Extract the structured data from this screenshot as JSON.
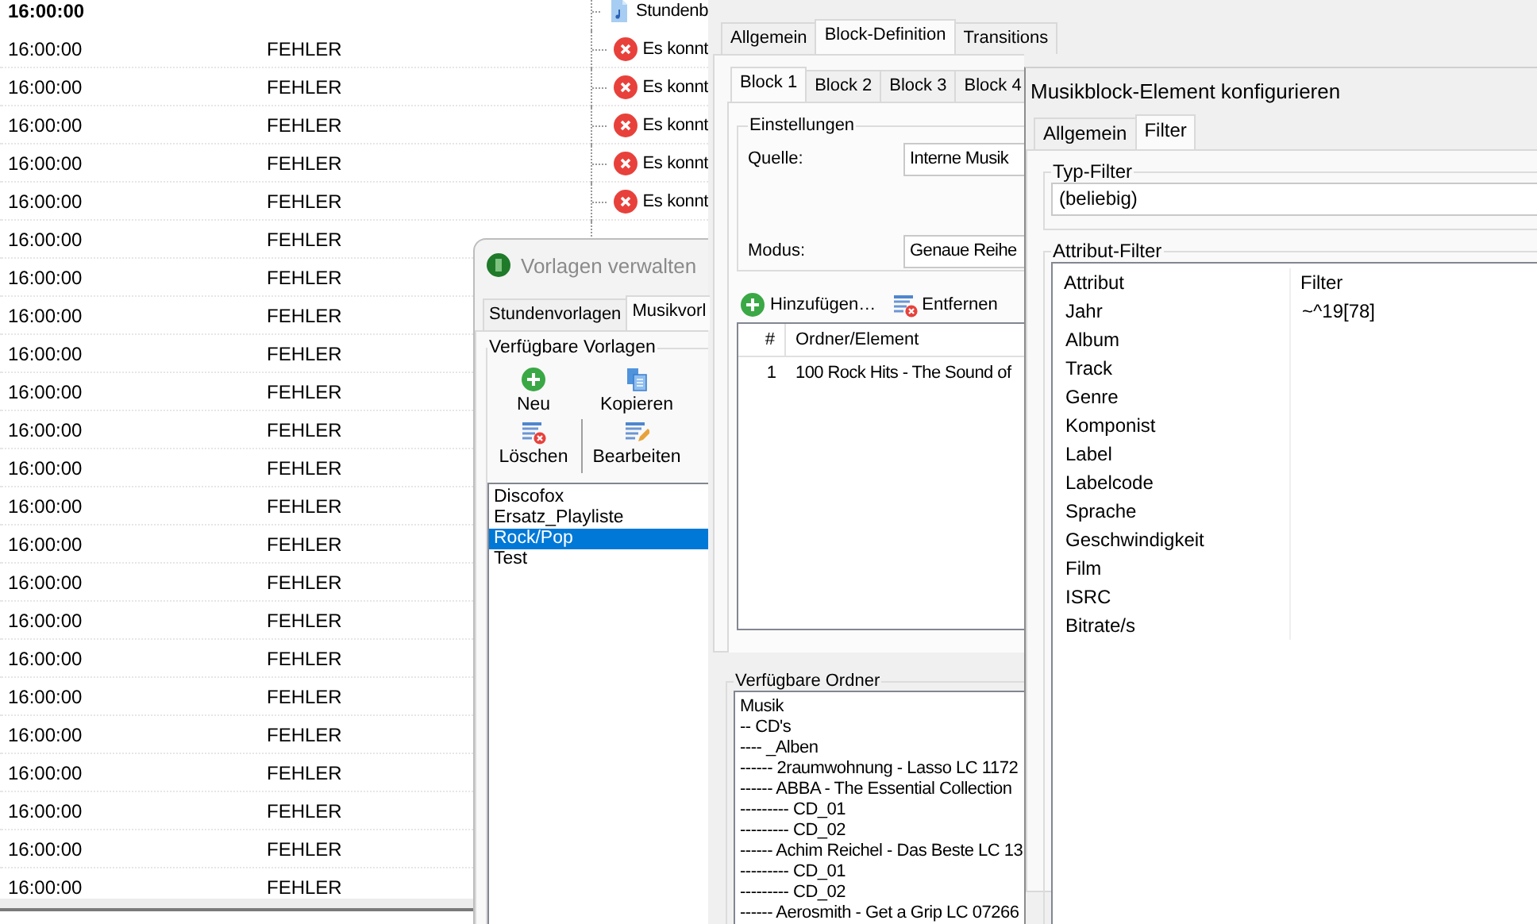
{
  "log": {
    "header": {
      "time": "16:00:00",
      "kind": "file",
      "message": "Stundenb"
    },
    "rows": [
      {
        "time": "16:00:00",
        "status": "FEHLER",
        "kind": "error",
        "message": "Es konnt"
      },
      {
        "time": "16:00:00",
        "status": "FEHLER",
        "kind": "error",
        "message": "Es konnt"
      },
      {
        "time": "16:00:00",
        "status": "FEHLER",
        "kind": "error",
        "message": "Es konnt"
      },
      {
        "time": "16:00:00",
        "status": "FEHLER",
        "kind": "error",
        "message": "Es konnt"
      },
      {
        "time": "16:00:00",
        "status": "FEHLER",
        "kind": "error",
        "message": "Es konnt"
      },
      {
        "time": "16:00:00",
        "status": "FEHLER"
      },
      {
        "time": "16:00:00",
        "status": "FEHLER"
      },
      {
        "time": "16:00:00",
        "status": "FEHLER"
      },
      {
        "time": "16:00:00",
        "status": "FEHLER"
      },
      {
        "time": "16:00:00",
        "status": "FEHLER"
      },
      {
        "time": "16:00:00",
        "status": "FEHLER"
      },
      {
        "time": "16:00:00",
        "status": "FEHLER"
      },
      {
        "time": "16:00:00",
        "status": "FEHLER"
      },
      {
        "time": "16:00:00",
        "status": "FEHLER"
      },
      {
        "time": "16:00:00",
        "status": "FEHLER"
      },
      {
        "time": "16:00:00",
        "status": "FEHLER"
      },
      {
        "time": "16:00:00",
        "status": "FEHLER"
      },
      {
        "time": "16:00:00",
        "status": "FEHLER"
      },
      {
        "time": "16:00:00",
        "status": "FEHLER"
      },
      {
        "time": "16:00:00",
        "status": "FEHLER"
      },
      {
        "time": "16:00:00",
        "status": "FEHLER"
      },
      {
        "time": "16:00:00",
        "status": "FEHLER"
      },
      {
        "time": "16:00:00",
        "status": "FEHLER"
      }
    ]
  },
  "block_window": {
    "tabs": [
      {
        "label": "Allgemein",
        "selected": false
      },
      {
        "label": "Block-Definition",
        "selected": true
      },
      {
        "label": "Transitions",
        "selected": false
      }
    ],
    "block_tabs": [
      {
        "label": "Block 1",
        "selected": true
      },
      {
        "label": "Block 2",
        "selected": false
      },
      {
        "label": "Block 3",
        "selected": false
      },
      {
        "label": "Block 4",
        "selected": false
      }
    ],
    "settings": {
      "title": "Einstellungen",
      "fields": [
        {
          "label": "Quelle:",
          "value": "Interne Musik"
        },
        {
          "label": "Modus:",
          "value": "Genaue Reihe"
        }
      ]
    },
    "toolbar": [
      {
        "kind": "add",
        "label": "Hinzufügen…"
      },
      {
        "kind": "remove",
        "label": "Entfernen"
      }
    ],
    "table": {
      "columns": [
        "#",
        "Ordner/Element"
      ],
      "rows": [
        [
          "1",
          "100 Rock Hits - The Sound of"
        ]
      ]
    },
    "folders": {
      "title": "Verfügbare Ordner",
      "items": [
        "Musik",
        "-- CD's",
        "---- _Alben",
        "------ 2raumwohnung - Lasso LC 1172",
        "------ ABBA - The Essential Collection",
        "--------- CD_01",
        "--------- CD_02",
        "------ Achim Reichel - Das Beste LC 13",
        "--------- CD_01",
        "--------- CD_02",
        "------ Aerosmith - Get a Grip LC 07266"
      ]
    }
  },
  "templates_window": {
    "title": "Vorlagen verwalten",
    "tabs": [
      {
        "label": "Stundenvorlagen",
        "selected": false
      },
      {
        "label": "Musikvorl",
        "selected": true
      }
    ],
    "group": "Verfügbare Vorlagen",
    "actions": [
      {
        "kind": "add",
        "label": "Neu"
      },
      {
        "kind": "copy",
        "label": "Kopieren"
      },
      {
        "kind": "delete",
        "label": "Löschen"
      },
      {
        "kind": "edit",
        "label": "Bearbeiten"
      }
    ],
    "items": [
      {
        "label": "Discofox",
        "selected": false
      },
      {
        "label": "Ersatz_Playliste",
        "selected": false
      },
      {
        "label": "Rock/Pop",
        "selected": true
      },
      {
        "label": "Test",
        "selected": false
      }
    ]
  },
  "element_window": {
    "title": "Musikblock-Element konfigurieren",
    "tabs": [
      {
        "label": "Allgemein",
        "selected": false
      },
      {
        "label": "Filter",
        "selected": true
      }
    ],
    "type_filter": {
      "title": "Typ-Filter",
      "value": "(beliebig)"
    },
    "attribute_filter": {
      "title": "Attribut-Filter",
      "columns": [
        "Attribut",
        "Filter"
      ],
      "rows": [
        {
          "attribute": "Jahr",
          "filter": "~^19[78]"
        },
        {
          "attribute": "Album"
        },
        {
          "attribute": "Track"
        },
        {
          "attribute": "Genre"
        },
        {
          "attribute": "Komponist"
        },
        {
          "attribute": "Label"
        },
        {
          "attribute": "Labelcode"
        },
        {
          "attribute": "Sprache"
        },
        {
          "attribute": "Geschwindigkeit"
        },
        {
          "attribute": "Film"
        },
        {
          "attribute": "ISRC"
        },
        {
          "attribute": "Bitrate/s"
        }
      ]
    }
  }
}
